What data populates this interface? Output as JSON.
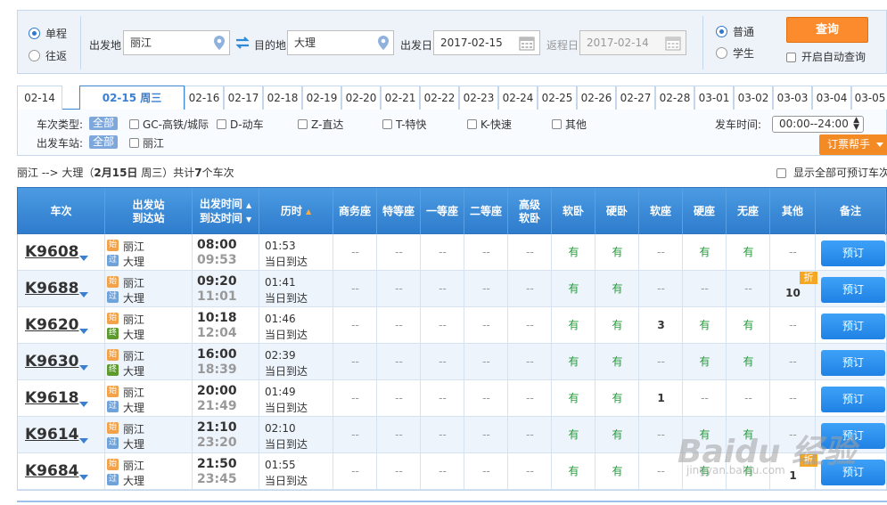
{
  "search": {
    "trip_one_way": "单程",
    "trip_round": "往返",
    "from_label": "出发地",
    "from_value": "丽江",
    "to_label": "目的地",
    "to_value": "大理",
    "depart_label": "出发日",
    "depart_value": "2017-02-15",
    "return_label": "返程日",
    "return_value": "2017-02-14",
    "ticket_normal": "普通",
    "ticket_student": "学生",
    "query_button": "查询",
    "auto_query": "开启自动查询"
  },
  "date_tabs": [
    "02-14",
    "02-15 周三",
    "02-16",
    "02-17",
    "02-18",
    "02-19",
    "02-20",
    "02-21",
    "02-22",
    "02-23",
    "02-24",
    "02-25",
    "02-26",
    "02-27",
    "02-28",
    "03-01",
    "03-02",
    "03-03",
    "03-04",
    "03-05"
  ],
  "active_tab": 1,
  "filters": {
    "type_label": "车次类型:",
    "station_label": "出发车站:",
    "all": "全部",
    "types": [
      "GC-高铁/城际",
      "D-动车",
      "Z-直达",
      "T-特快",
      "K-快速",
      "其他"
    ],
    "station": "丽江",
    "time_label": "发车时间:",
    "time_value": "00:00--24:00",
    "helper": "订票帮手"
  },
  "summary": {
    "route": "丽江 --> 大理",
    "prefix": "（",
    "date": "2月15日",
    "week": "周三",
    "suffix": "）共计",
    "count": "7",
    "unit": "个车次",
    "show_all": "显示全部可预订车次"
  },
  "headers": {
    "train": "车次",
    "station_1": "出发站",
    "station_2": "到达站",
    "time_1": "出发时间",
    "time_2": "到达时间",
    "duration": "历时",
    "seats": [
      "商务座",
      "特等座",
      "一等座",
      "二等座",
      "高级\n软卧",
      "软卧",
      "硬卧",
      "软座",
      "硬座",
      "无座",
      "其他"
    ],
    "remark": "备注"
  },
  "badges": {
    "start": "始",
    "pass": "过",
    "end": "终"
  },
  "book_label": "预订",
  "discount": "折",
  "arrive_text": "当日到达",
  "trains": [
    {
      "no": "K9608",
      "from": "丽江",
      "to": "大理",
      "from_badge": "start",
      "to_badge": "pass",
      "dep": "08:00",
      "arr": "09:53",
      "dur": "01:53",
      "seats": [
        "--",
        "--",
        "--",
        "--",
        "--",
        "有",
        "有",
        "--",
        "有",
        "有",
        "--"
      ]
    },
    {
      "no": "K9688",
      "from": "丽江",
      "to": "大理",
      "from_badge": "start",
      "to_badge": "pass",
      "dep": "09:20",
      "arr": "11:01",
      "dur": "01:41",
      "seats": [
        "--",
        "--",
        "--",
        "--",
        "--",
        "有",
        "有",
        "--",
        "--",
        "--",
        "10"
      ],
      "discount": true
    },
    {
      "no": "K9620",
      "from": "丽江",
      "to": "大理",
      "from_badge": "start",
      "to_badge": "end",
      "dep": "10:18",
      "arr": "12:04",
      "dur": "01:46",
      "seats": [
        "--",
        "--",
        "--",
        "--",
        "--",
        "有",
        "有",
        "3",
        "有",
        "有",
        "--"
      ]
    },
    {
      "no": "K9630",
      "from": "丽江",
      "to": "大理",
      "from_badge": "start",
      "to_badge": "end",
      "dep": "16:00",
      "arr": "18:39",
      "dur": "02:39",
      "seats": [
        "--",
        "--",
        "--",
        "--",
        "--",
        "有",
        "有",
        "--",
        "有",
        "有",
        "--"
      ]
    },
    {
      "no": "K9618",
      "from": "丽江",
      "to": "大理",
      "from_badge": "start",
      "to_badge": "pass",
      "dep": "20:00",
      "arr": "21:49",
      "dur": "01:49",
      "seats": [
        "--",
        "--",
        "--",
        "--",
        "--",
        "有",
        "有",
        "1",
        "--",
        "--",
        "--"
      ]
    },
    {
      "no": "K9614",
      "from": "丽江",
      "to": "大理",
      "from_badge": "start",
      "to_badge": "pass",
      "dep": "21:10",
      "arr": "23:20",
      "dur": "02:10",
      "seats": [
        "--",
        "--",
        "--",
        "--",
        "--",
        "有",
        "有",
        "--",
        "有",
        "有",
        "--"
      ]
    },
    {
      "no": "K9684",
      "from": "丽江",
      "to": "大理",
      "from_badge": "start",
      "to_badge": "pass",
      "dep": "21:50",
      "arr": "23:45",
      "dur": "01:55",
      "seats": [
        "--",
        "--",
        "--",
        "--",
        "--",
        "有",
        "有",
        "--",
        "有",
        "有",
        "1"
      ],
      "discount": true
    }
  ],
  "watermark": {
    "brand": "Baidu 经验",
    "url": "jingyan.baidu.com"
  },
  "colors": {
    "primary": "#3a8ad8",
    "orange": "#fb8b2c",
    "green": "#249a3a"
  }
}
